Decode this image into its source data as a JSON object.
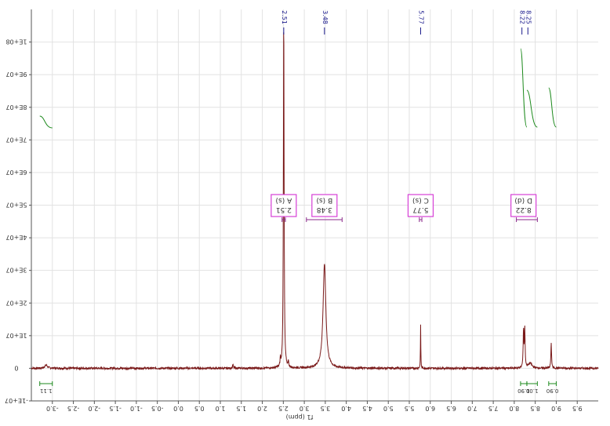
{
  "chart_data": {
    "type": "line",
    "mirrored": true,
    "x_axis_title": "f1 (ppm)",
    "x_ticks": [
      "-3.0",
      "-2.5",
      "-2.0",
      "-1.5",
      "-1.0",
      "-0.5",
      "0.0",
      "0.5",
      "1.0",
      "1.5",
      "2.0",
      "2.5",
      "3.0",
      "3.5",
      "4.0",
      "4.5",
      "5.0",
      "5.5",
      "6.0",
      "6.5",
      "7.0",
      "7.5",
      "8.0",
      "8.5",
      "9.0",
      "9.5"
    ],
    "xlim": [
      -3.5,
      10.0
    ],
    "y_ticks": [
      "-1E+07",
      "0",
      "1E+07",
      "2E+07",
      "3E+07",
      "4E+07",
      "5E+07",
      "6E+07",
      "7E+07",
      "8E+07",
      "9E+07",
      "1E+08"
    ],
    "ylim": [
      -10000000.0,
      110000000.0
    ],
    "grid": true,
    "line_color": "#7a1a1a",
    "peaks": [
      {
        "ppm": -3.15,
        "height": 1000000.0,
        "width": 0.04
      },
      {
        "ppm": 1.3,
        "height": 1200000.0,
        "width": 0.01
      },
      {
        "ppm": 2.43,
        "height": 2500000.0,
        "width": 0.008
      },
      {
        "ppm": 2.51,
        "height": 109000000.0,
        "width": 0.01
      },
      {
        "ppm": 2.62,
        "height": 2000000.0,
        "width": 0.008
      },
      {
        "ppm": 3.48,
        "height": 32000000.0,
        "width": 0.04
      },
      {
        "ppm": 5.77,
        "height": 13500000.0,
        "width": 0.005
      },
      {
        "ppm": 8.22,
        "height": 11500000.0,
        "width": 0.01
      },
      {
        "ppm": 8.25,
        "height": 12000000.0,
        "width": 0.01
      },
      {
        "ppm": 8.38,
        "height": 1500000.0,
        "width": 0.05
      },
      {
        "ppm": 8.88,
        "height": 7500000.0,
        "width": 0.01
      }
    ],
    "peak_labels": [
      {
        "ppm": 2.51,
        "text": "2.51"
      },
      {
        "ppm": 3.48,
        "text": "3.48"
      },
      {
        "ppm": 5.77,
        "text": "5.77"
      },
      {
        "ppm": 8.22,
        "text": "8.22"
      },
      {
        "ppm": 8.25,
        "text": "8.25"
      }
    ],
    "multiplet_boxes": [
      {
        "ppm": 2.51,
        "line1": "A (s)",
        "line2": "2.51",
        "range": [
          2.47,
          2.55
        ]
      },
      {
        "ppm": 3.48,
        "line1": "B (s)",
        "line2": "3.48",
        "range": [
          3.05,
          3.9
        ]
      },
      {
        "ppm": 5.77,
        "line1": "C (s)",
        "line2": "5.77",
        "range": [
          5.74,
          5.8
        ]
      },
      {
        "ppm": 8.22,
        "line1": "D (d)",
        "line2": "8.22",
        "range": [
          8.05,
          8.55
        ]
      }
    ],
    "integrals": [
      {
        "start": -3.3,
        "end": -3.0,
        "label": "1.11"
      },
      {
        "start": 8.15,
        "end": 8.3,
        "label": "1.90"
      },
      {
        "start": 8.3,
        "end": 8.55,
        "label": "1.00"
      },
      {
        "start": 8.82,
        "end": 9.0,
        "label": "0.90"
      }
    ]
  }
}
